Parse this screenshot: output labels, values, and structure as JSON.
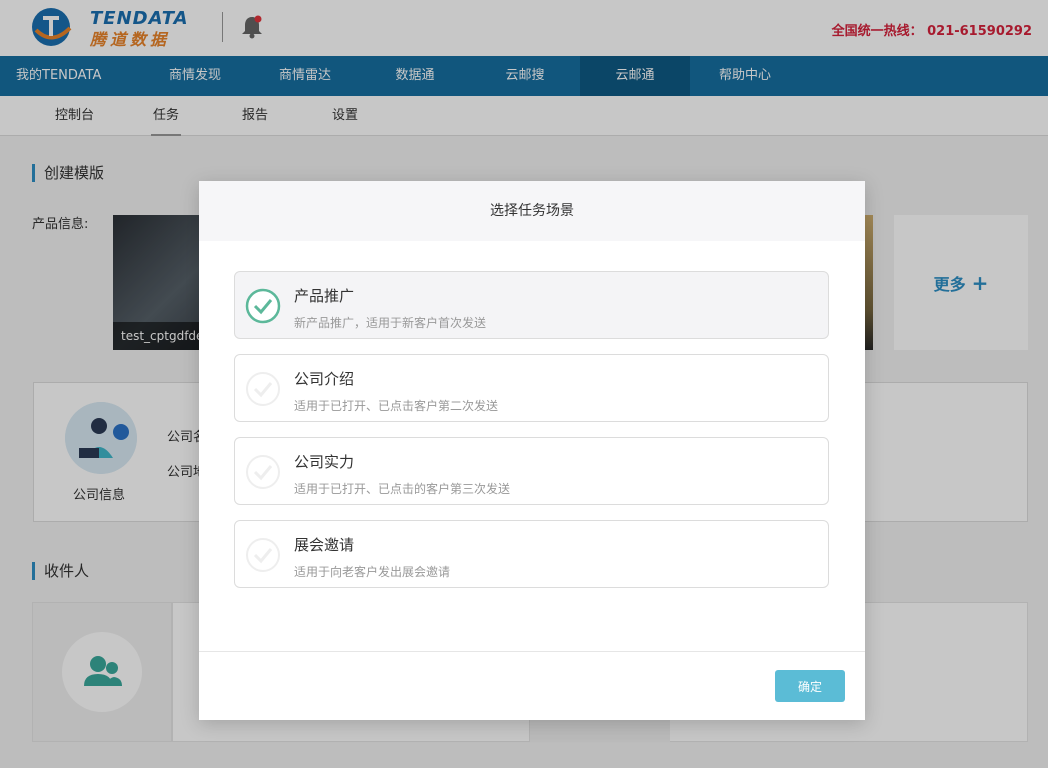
{
  "header": {
    "logo_en": "TENDATA",
    "logo_cn": "腾道数据",
    "hotline": "全国统一热线： 021-61590292"
  },
  "nav": {
    "items": [
      {
        "label": "我的TENDATA"
      },
      {
        "label": "商情发现"
      },
      {
        "label": "商情雷达"
      },
      {
        "label": "数据通"
      },
      {
        "label": "云邮搜"
      },
      {
        "label": "云邮通",
        "active": true
      },
      {
        "label": "帮助中心"
      }
    ]
  },
  "subnav": {
    "items": [
      {
        "label": "控制台"
      },
      {
        "label": "任务",
        "active": true
      },
      {
        "label": "报告"
      },
      {
        "label": "设置"
      }
    ]
  },
  "content": {
    "create_title": "创建模版",
    "product_label": "产品信息:",
    "product_caption": "test_cptgdfde",
    "more_label": "更多",
    "company_label": "公司信息",
    "company_field_1": "公司名",
    "company_field_2": "公司地",
    "receivers_title": "收件人"
  },
  "modal": {
    "title": "选择任务场景",
    "options": [
      {
        "title": "产品推广",
        "desc": "新产品推广，适用于新客户首次发送",
        "selected": true
      },
      {
        "title": "公司介绍",
        "desc": "适用于已打开、已点击客户第二次发送",
        "selected": false
      },
      {
        "title": "公司实力",
        "desc": "适用于已打开、已点击的客户第三次发送",
        "selected": false
      },
      {
        "title": "展会邀请",
        "desc": "适用于向老客户发出展会邀请",
        "selected": false
      }
    ],
    "confirm_label": "确定"
  },
  "colors": {
    "nav_bg": "#176fa0",
    "nav_active": "#0f5a84",
    "accent": "#2d8fc4",
    "check_green": "#5cb89a",
    "confirm_btn": "#5bbcd6",
    "hotline_red": "#d6223c"
  }
}
